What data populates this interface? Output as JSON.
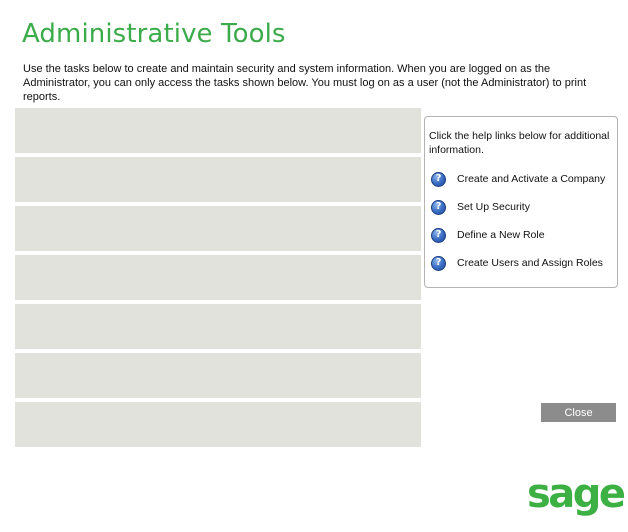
{
  "page": {
    "title": "Administrative Tools",
    "intro": "Use the tasks below to create and maintain security and system information.  When you are logged on as the Administrator, you can only access the tasks shown below.  You must log on as a user (not the Administrator) to print reports."
  },
  "tasks": {
    "rows": 7,
    "row_color": "#e2e2dd"
  },
  "help": {
    "intro": "Click the help links below  for additional information.",
    "icon": "help-question-icon",
    "links": [
      {
        "label": "Create and Activate a Company"
      },
      {
        "label": "Set Up Security"
      },
      {
        "label": "Define a New Role"
      },
      {
        "label": "Create Users and Assign Roles"
      }
    ]
  },
  "actions": {
    "close_label": "Close"
  },
  "brand": {
    "logo_text": "sage",
    "accent_color": "#3cac4a"
  }
}
